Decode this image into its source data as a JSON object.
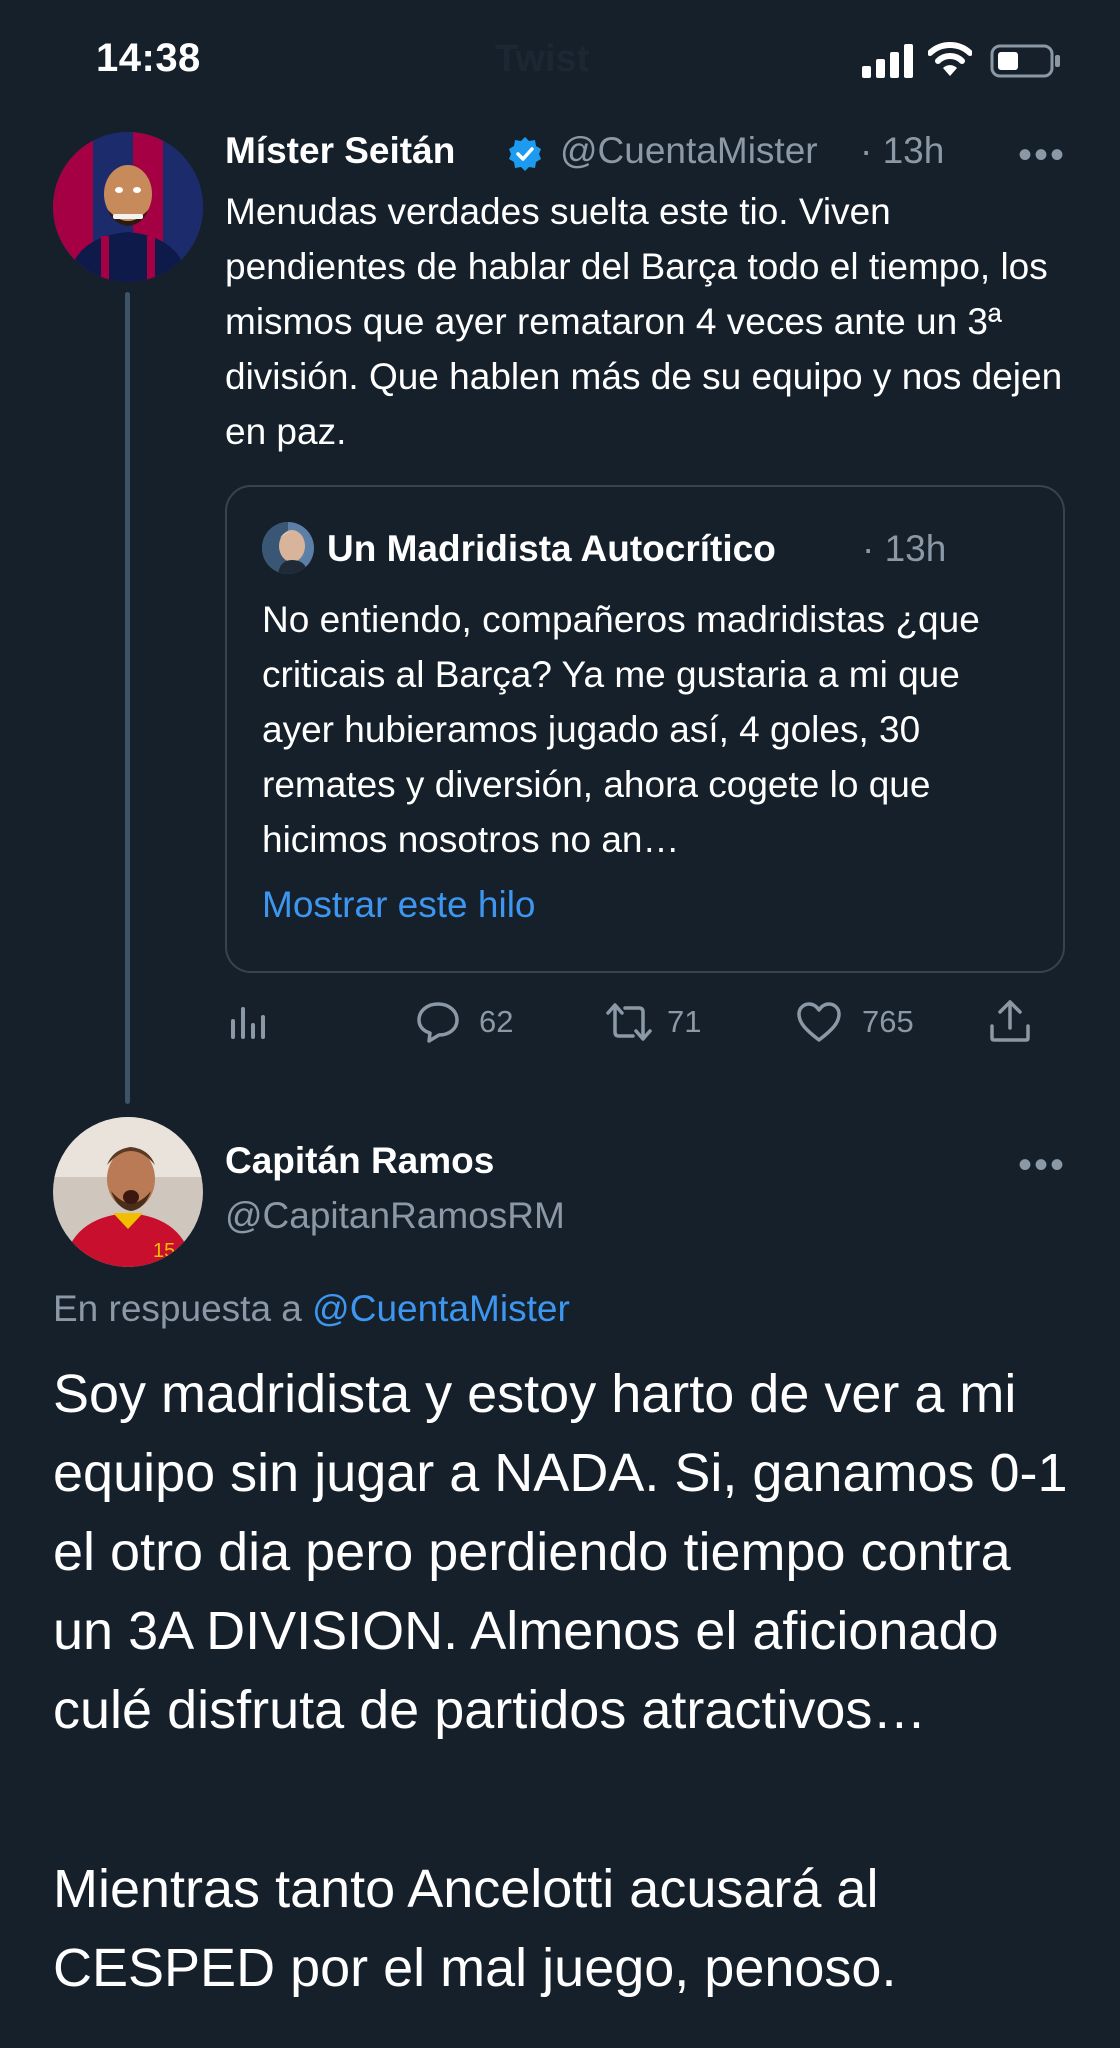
{
  "status_bar": {
    "time": "14:38",
    "faded_title": "Twist"
  },
  "tweet1": {
    "name": "Míster Seitán",
    "handle": "@CuentaMister",
    "time": "· 13h",
    "verified": true,
    "more": "•••",
    "text": "Menudas verdades suelta este tio. Viven pendientes de hablar del Barça todo el tiempo, los mismos que ayer remataron 4 veces ante un 3ª división. Que hablen más de su equipo y nos dejen en paz.",
    "quote": {
      "name": "Un Madridista Autocrítico",
      "time": "· 13h",
      "text": "No entiendo, compañeros madridistas ¿que criticais al Barça? Ya me gustaria a mi que ayer hubieramos jugado así, 4 goles, 30 remates y diversión, ahora cogete lo que hicimos nosotros no an…",
      "show_thread": "Mostrar este hilo"
    },
    "actions": {
      "replies": "62",
      "retweets": "71",
      "likes": "765"
    }
  },
  "tweet2": {
    "name": "Capitán Ramos",
    "handle": "@CapitanRamosRM",
    "more": "•••",
    "reply_prefix": "En respuesta a",
    "reply_to": "@CuentaMister",
    "paragraph1": "Soy madridista y estoy harto de ver a mi equipo sin jugar a NADA. Si, ganamos 0-1 el otro dia pero perdiendo tiempo contra un 3A DIVISION. Almenos el aficionado culé disfruta de partidos atractivos…",
    "paragraph2": "Mientras tanto Ancelotti acusará al CESPED por el mal juego, penoso."
  },
  "colors": {
    "background": "#15202b",
    "accent": "#1d9bf0",
    "muted": "#8b98a5",
    "border": "#38444d"
  }
}
